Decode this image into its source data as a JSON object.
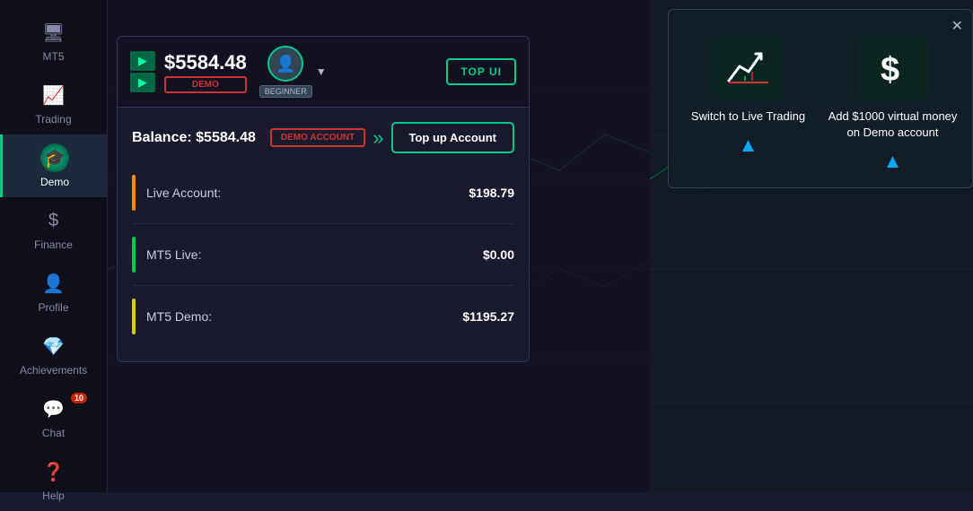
{
  "sidebar": {
    "items": [
      {
        "id": "mt5",
        "label": "MT5",
        "icon": "🖥",
        "active": false
      },
      {
        "id": "trading",
        "label": "Trading",
        "icon": "📈",
        "active": false
      },
      {
        "id": "demo",
        "label": "Demo",
        "icon": "🎓",
        "active": true
      },
      {
        "id": "finance",
        "label": "Finance",
        "icon": "$",
        "active": false
      },
      {
        "id": "profile",
        "label": "Profile",
        "icon": "👤",
        "active": false
      },
      {
        "id": "achievements",
        "label": "Achievements",
        "icon": "💎",
        "active": false
      },
      {
        "id": "chat",
        "label": "Chat",
        "icon": "💬",
        "active": false,
        "badge": "10"
      },
      {
        "id": "help",
        "label": "Help",
        "icon": "❓",
        "active": false
      }
    ]
  },
  "header": {
    "balance": "$5584.48",
    "demo_label": "DEMO",
    "user_level": "BEGINNER",
    "top_ui_label": "TOP UI"
  },
  "account_panel": {
    "balance_label": "Balance: $5584.48",
    "demo_account_btn": "DEMO ACCOUNT",
    "top_up_btn": "Top up Account",
    "accounts": [
      {
        "id": "live",
        "label": "Live Account:",
        "value": "$198.79",
        "color": "#ff8800"
      },
      {
        "id": "mt5live",
        "label": "MT5 Live:",
        "value": "$0.00",
        "color": "#00cc44"
      },
      {
        "id": "mt5demo",
        "label": "MT5 Demo:",
        "value": "$1195.27",
        "color": "#ddcc00"
      }
    ]
  },
  "modal": {
    "close_label": "✕",
    "option1": {
      "icon": "📈",
      "label": "Switch to Live Trading"
    },
    "option2": {
      "icon": "$",
      "label": "Add $1000 virtual money on Demo account"
    }
  }
}
